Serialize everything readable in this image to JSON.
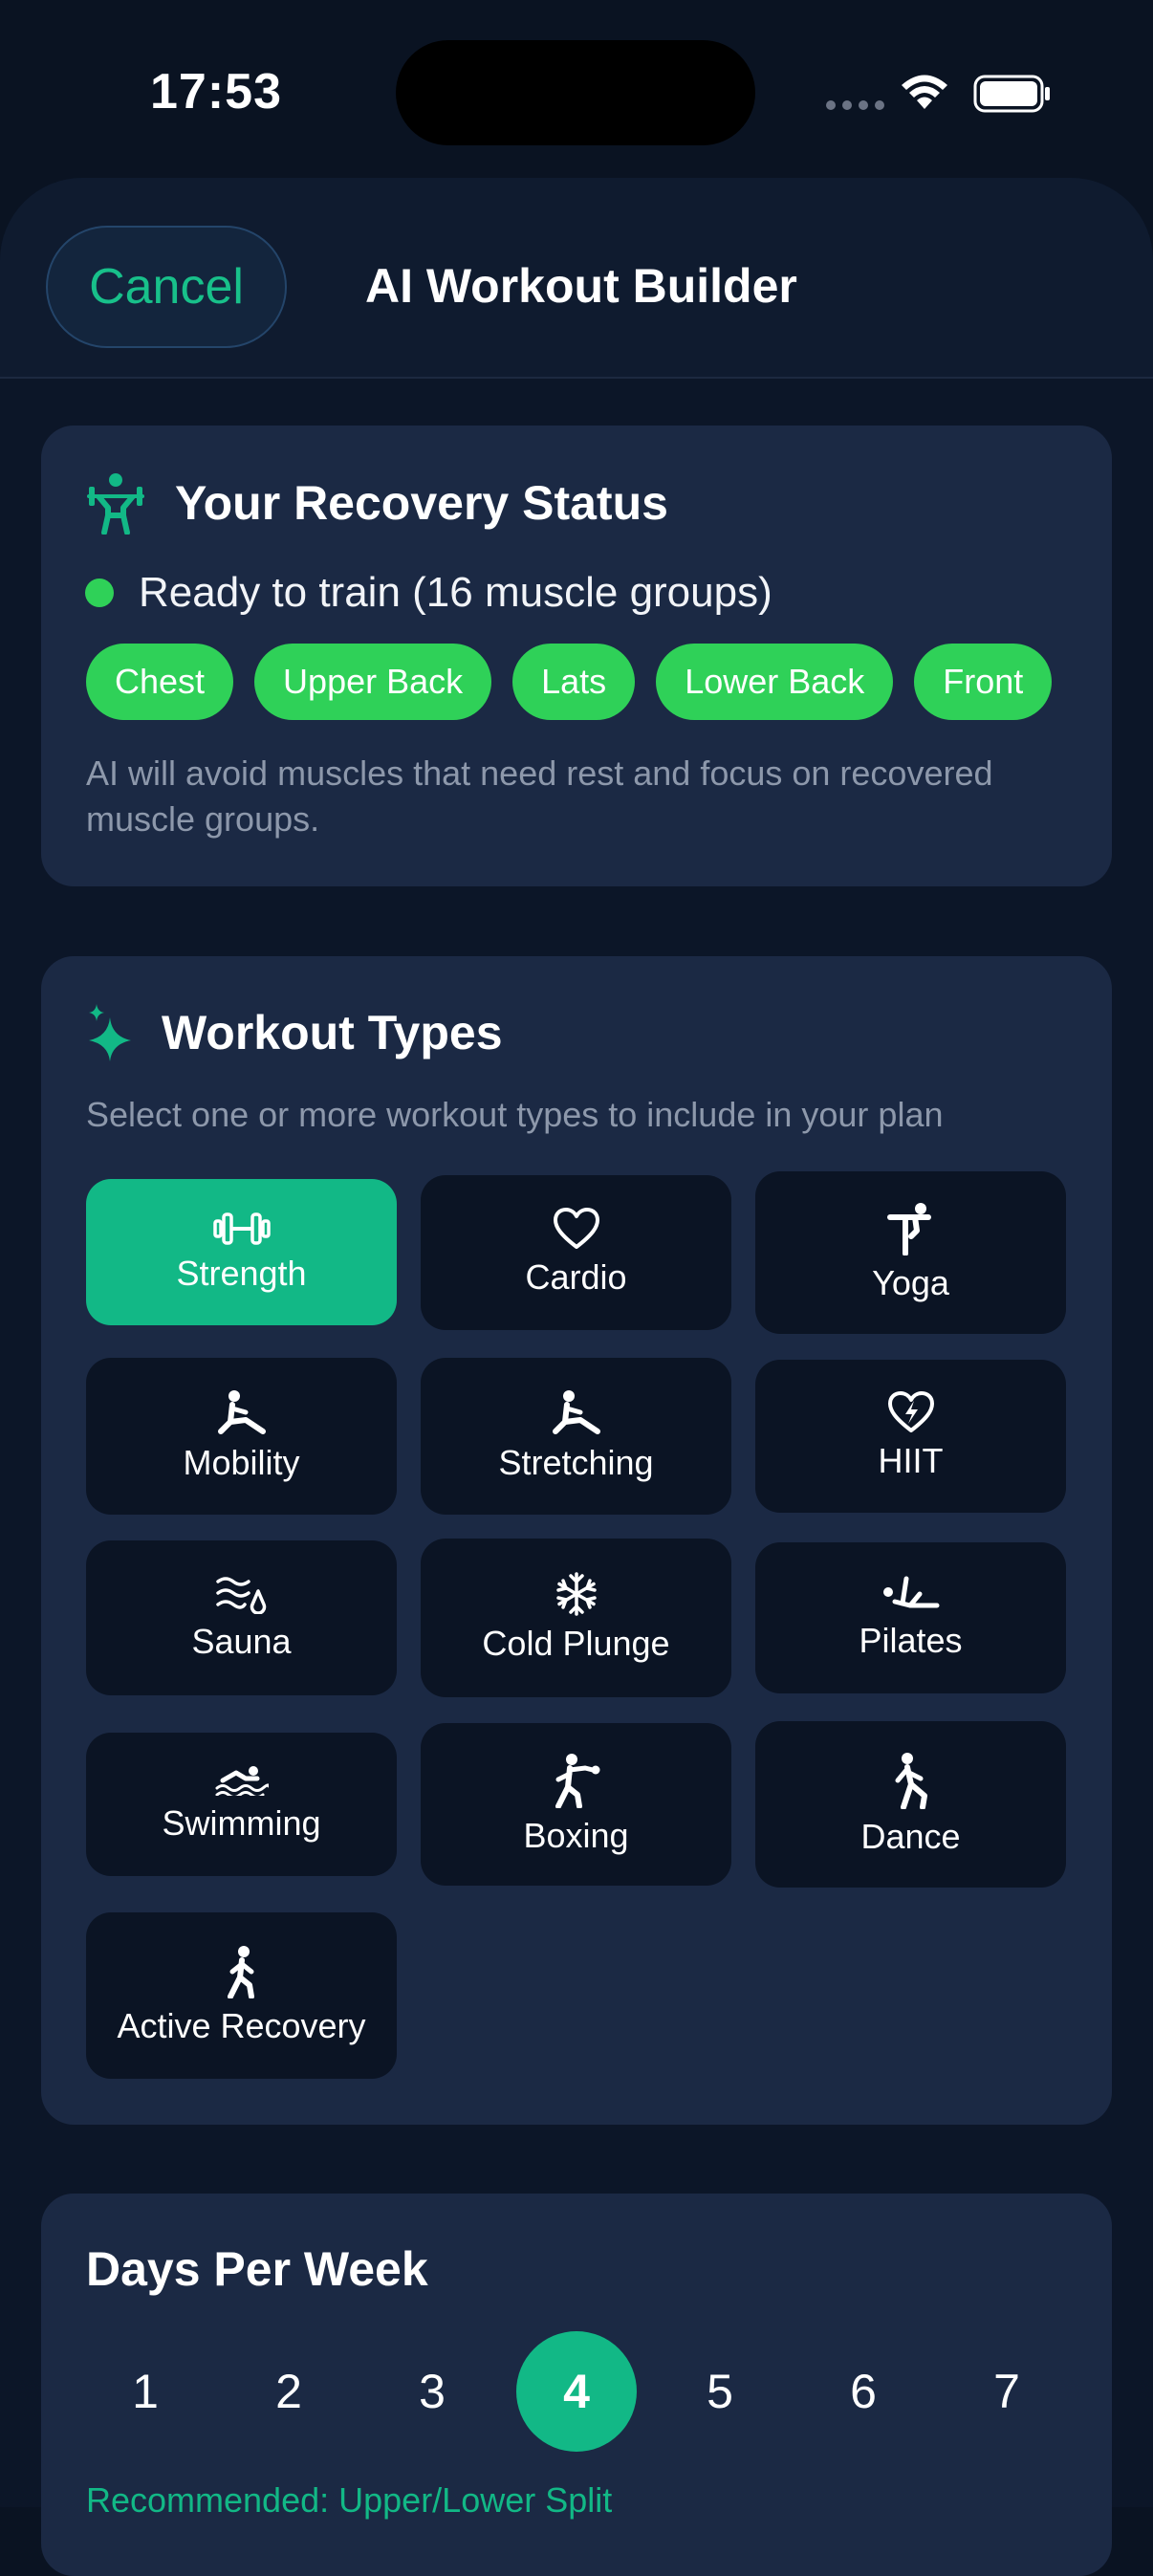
{
  "status_bar": {
    "time": "17:53"
  },
  "nav": {
    "cancel_label": "Cancel",
    "title": "AI Workout Builder"
  },
  "recovery": {
    "title": "Your Recovery Status",
    "ready_text": "Ready to train (16 muscle groups)",
    "chips": [
      "Chest",
      "Upper Back",
      "Lats",
      "Lower Back",
      "Front"
    ],
    "note": "AI will avoid muscles that need rest and focus on recovered muscle groups."
  },
  "workout_types": {
    "title": "Workout Types",
    "subtitle": "Select one or more workout types to include in your plan",
    "items": [
      {
        "label": "Strength",
        "icon": "dumbbell-icon",
        "selected": true
      },
      {
        "label": "Cardio",
        "icon": "heart-icon",
        "selected": false
      },
      {
        "label": "Yoga",
        "icon": "yoga-pose-icon",
        "selected": false
      },
      {
        "label": "Mobility",
        "icon": "stretch-figure-icon",
        "selected": false
      },
      {
        "label": "Stretching",
        "icon": "stretch-figure-icon",
        "selected": false
      },
      {
        "label": "HIIT",
        "icon": "heart-bolt-icon",
        "selected": false
      },
      {
        "label": "Sauna",
        "icon": "heat-waves-drop-icon",
        "selected": false
      },
      {
        "label": "Cold Plunge",
        "icon": "snowflake-icon",
        "selected": false
      },
      {
        "label": "Pilates",
        "icon": "pilates-figure-icon",
        "selected": false
      },
      {
        "label": "Swimming",
        "icon": "swimmer-icon",
        "selected": false
      },
      {
        "label": "Boxing",
        "icon": "boxing-figure-icon",
        "selected": false
      },
      {
        "label": "Dance",
        "icon": "dance-figure-icon",
        "selected": false
      },
      {
        "label": "Active Recovery",
        "icon": "walking-figure-icon",
        "selected": false
      }
    ]
  },
  "days": {
    "title": "Days Per Week",
    "options": [
      "1",
      "2",
      "3",
      "4",
      "5",
      "6",
      "7"
    ],
    "selected": "4",
    "recommended": "Recommended: Upper/Lower Split"
  },
  "colors": {
    "accent": "#12b886",
    "ready_green": "#2fd158",
    "card_bg": "#1b2944",
    "tile_bg": "#0b1424"
  }
}
